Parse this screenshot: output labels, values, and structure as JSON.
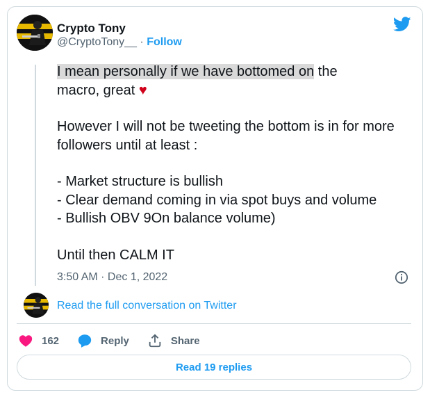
{
  "author": {
    "name": "Crypto Tony",
    "handle": "@CryptoTony__",
    "separator": "·",
    "follow_label": "Follow"
  },
  "tweet": {
    "line1_highlighted": "I mean personally if we have bottomed on",
    "line1_rest": " the",
    "line2": "macro, great ",
    "heart": "♥",
    "para2": "However I will not be tweeting the bottom is in for more followers until at least :",
    "bullets": [
      "- Market structure is bullish",
      "- Clear demand coming in via spot buys and volume",
      "- Bullish OBV 9On balance volume)"
    ],
    "closing": "Until then CALM IT"
  },
  "timestamp": "3:50 AM · Dec 1, 2022",
  "conversation_link": "Read the full conversation on Twitter",
  "actions": {
    "likes_count": "162",
    "reply_label": "Reply",
    "share_label": "Share"
  },
  "read_replies_label": "Read 19 replies",
  "colors": {
    "accent": "#1d9bf0",
    "like": "#f91880",
    "heart_emoji": "#d0021b",
    "highlight": "#d9d9d9"
  },
  "icons": [
    "avatar",
    "twitter-bird-icon",
    "info-icon",
    "heart-icon",
    "reply-icon",
    "share-icon"
  ]
}
